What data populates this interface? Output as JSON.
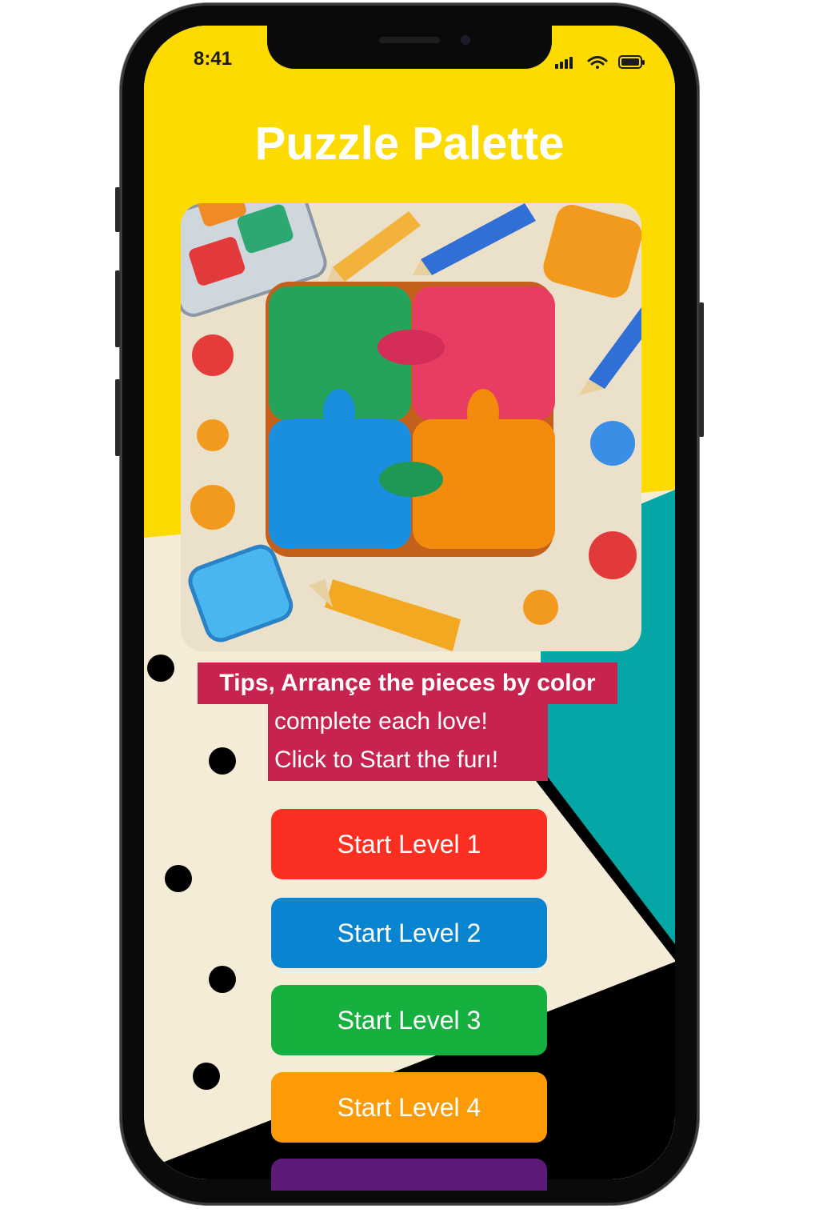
{
  "status_bar": {
    "time": "8:41",
    "signal_icon": "cellular-signal-icon",
    "wifi_icon": "wifi-icon",
    "battery_icon": "battery-icon"
  },
  "header": {
    "title": "Puzzle Palette"
  },
  "hero": {
    "icon": "puzzle-illustration"
  },
  "tips": {
    "line1": "Tips, Arrançe the pieces by color",
    "line2": "complete each love!",
    "line3": "Click to Start the furı!"
  },
  "levels": [
    {
      "label": "Start Level 1",
      "color": "#fb2e22"
    },
    {
      "label": "Start Level 2",
      "color": "#0984d0"
    },
    {
      "label": "Start Level 3",
      "color": "#16b03f"
    },
    {
      "label": "Start Level 4",
      "color": "#fc9b05"
    }
  ],
  "partial_level": {
    "color": "#5c1a79"
  },
  "colors": {
    "header_yellow": "#fedb00",
    "cream": "#f5ecd8",
    "teal": "#04a7a5",
    "tips_bg": "#c7234f"
  }
}
